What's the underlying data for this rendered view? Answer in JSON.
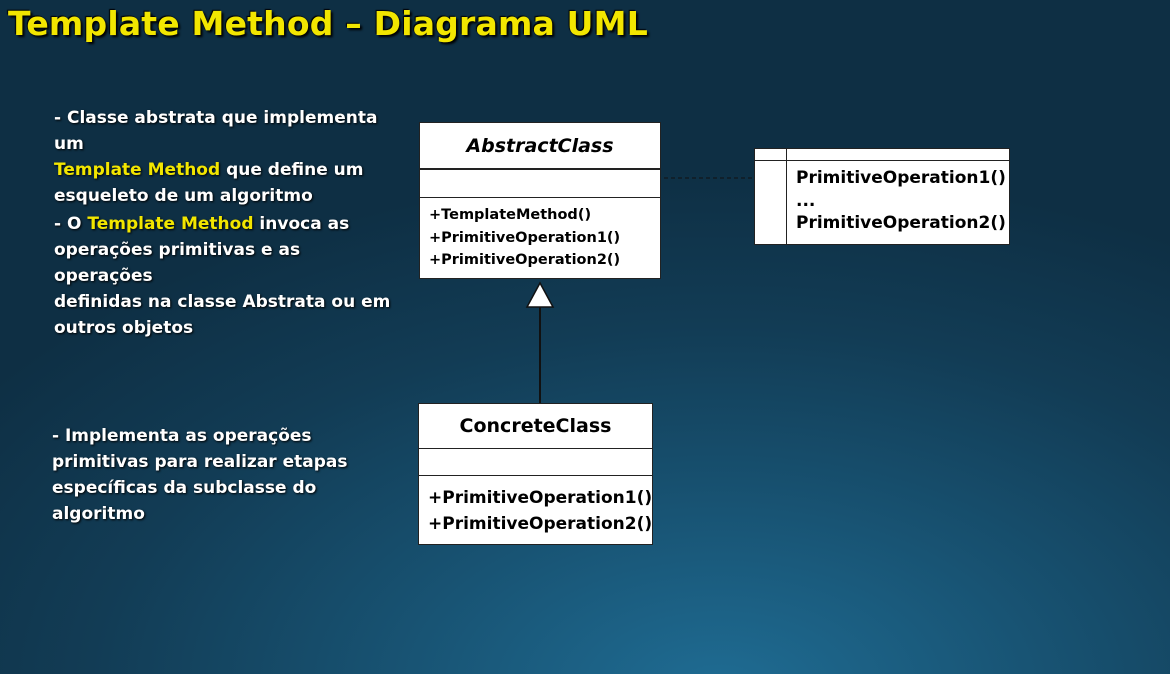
{
  "title": "Template Method – Diagrama UML",
  "notes": {
    "note1": {
      "part1": "- Classe abstrata que implementa um",
      "highlight": "Template Method",
      "part2": " que define um",
      "part3": "esqueleto de um algoritmo"
    },
    "note2": {
      "prefix": "-  O ",
      "highlight": "Template Method",
      "part1": " invoca as",
      "part2": "operações primitivas e as operações",
      "part3": "definidas na classe Abstrata ou em",
      "part4": "outros objetos"
    },
    "note3": {
      "line1": "-  Implementa as operações",
      "line2": "primitivas para realizar etapas",
      "line3": "específicas da subclasse do algoritmo"
    }
  },
  "abstract_class": {
    "name": "AbstractClass",
    "operations": [
      "+TemplateMethod()",
      "+PrimitiveOperation1()",
      "+PrimitiveOperation2()"
    ]
  },
  "concrete_class": {
    "name": "ConcreteClass",
    "operations": [
      "+PrimitiveOperation1()",
      "+PrimitiveOperation2()"
    ]
  },
  "comment_note": {
    "lines": [
      "PrimitiveOperation1()",
      "...",
      "PrimitiveOperation2()"
    ]
  }
}
